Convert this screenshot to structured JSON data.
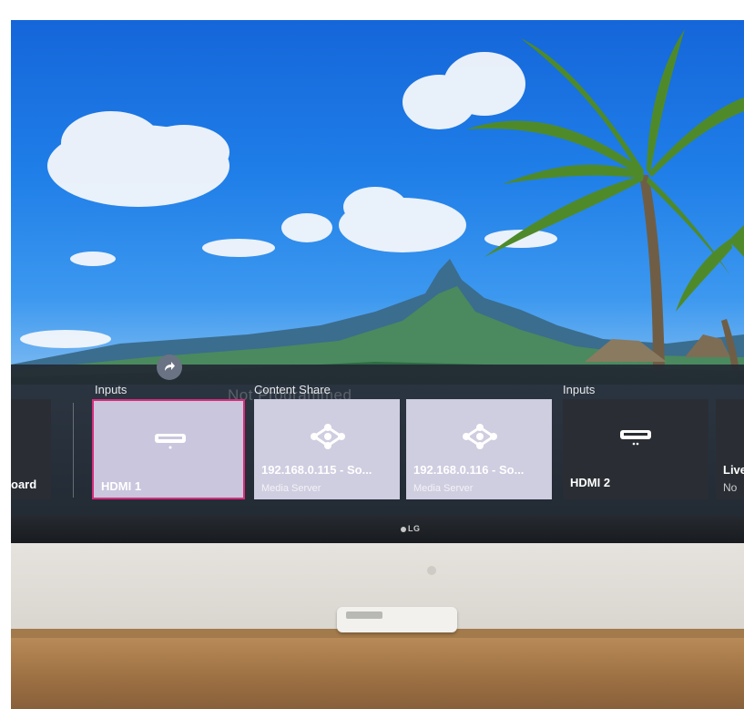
{
  "tv": {
    "brand": "LG",
    "launcher": {
      "sections": [
        {
          "label": "Inputs"
        },
        {
          "label": "Content Share"
        },
        {
          "label": "Inputs"
        }
      ],
      "ghost_text": "Not Programmed",
      "cards": [
        {
          "title": "oard",
          "subtitle": "",
          "icon": "none"
        },
        {
          "title": "HDMI 1",
          "subtitle": "",
          "icon": "hdmi-icon",
          "selected": true
        },
        {
          "title": "192.168.0.115 - So...",
          "subtitle": "Media Server",
          "icon": "network-share-icon"
        },
        {
          "title": "192.168.0.116 - So...",
          "subtitle": "Media Server",
          "icon": "network-share-icon"
        },
        {
          "title": "HDMI 2",
          "subtitle": "",
          "icon": "hdmi-icon"
        },
        {
          "title": "Live",
          "subtitle": "No",
          "icon": "none"
        }
      ]
    }
  },
  "colors": {
    "selection_border": "#d92c7c",
    "card_light": "#cfcde0",
    "card_dark": "#2a2e34",
    "sky_top": "#1566d9"
  }
}
